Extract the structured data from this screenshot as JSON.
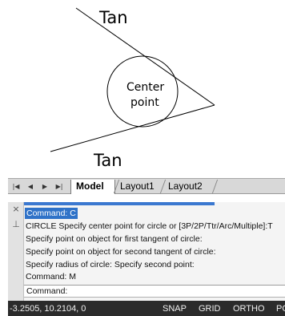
{
  "drawing": {
    "tan_top_label": "Tan",
    "tan_bottom_label": "Tan",
    "center_label_line1": "Center",
    "center_label_line2": "point"
  },
  "tabs": {
    "nav": [
      "|◀",
      "◀",
      "▶",
      "▶|"
    ],
    "items": [
      "Model",
      "Layout1",
      "Layout2"
    ],
    "active": "Model"
  },
  "command_window": {
    "history": [
      "Command: C",
      "CIRCLE Specify center point for circle or [3P/2P/Ttr/Arc/Multiple]:T",
      "Specify point on object for first tangent of circle:",
      "Specify point on object for second tangent of circle:",
      "Specify radius of circle:  Specify second point:",
      "Command: M"
    ],
    "input_label": "Command:",
    "input_value": "",
    "close_icon": "×",
    "pin_icon": "⊥"
  },
  "status_bar": {
    "coordinates": "-3.2505, 10.2104, 0",
    "buttons": [
      "SNAP",
      "GRID",
      "ORTHO",
      "PO"
    ]
  },
  "colors": {
    "highlight": "#2f72c8",
    "status_bg": "#2b2b2b",
    "status_text": "#f0f0f0"
  }
}
